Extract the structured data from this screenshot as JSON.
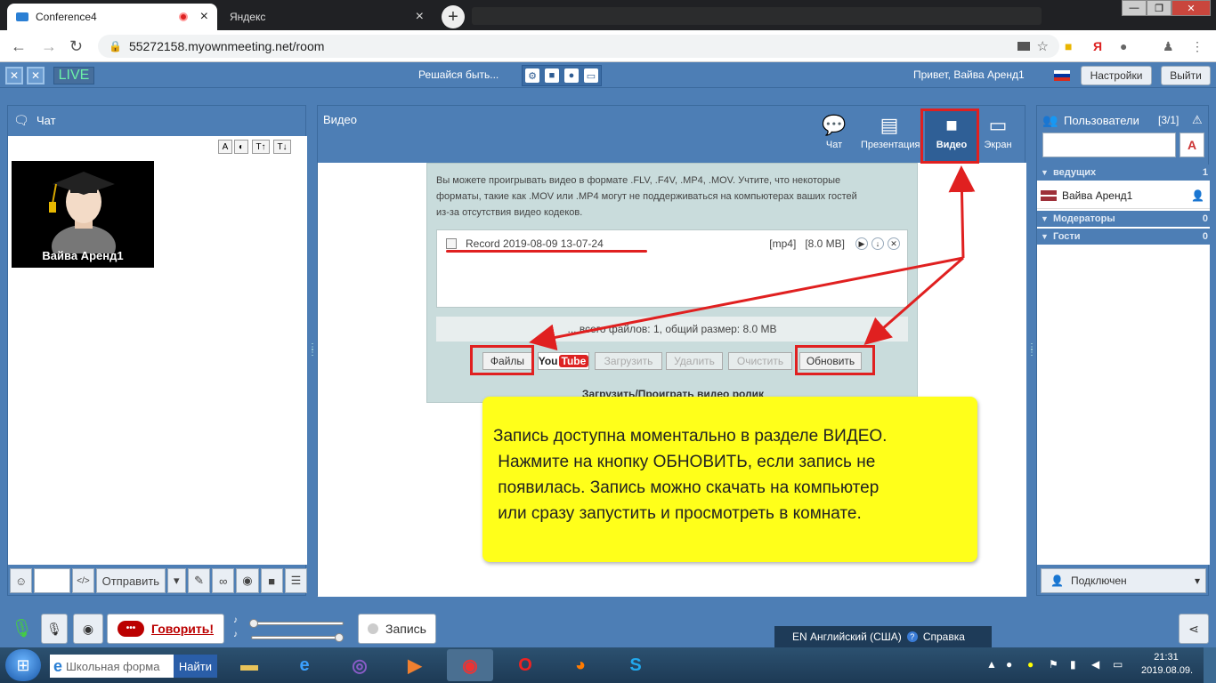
{
  "browser": {
    "tabs": [
      {
        "title": "Conference4",
        "active": true
      },
      {
        "title": "Яндекс",
        "active": false
      }
    ],
    "url": "55272158.myownmeeting.net/room",
    "new_tab": "+",
    "window_controls": [
      "—",
      "❐",
      "✕"
    ],
    "nav_icons": [
      "←",
      "→",
      "↻"
    ]
  },
  "app": {
    "logo_text": "LIVE",
    "motto": "Решайся быть...",
    "greeting": "Привет, Вайва Аренд1",
    "settings_label": "Настройки",
    "logout_label": "Выйти"
  },
  "chat": {
    "title": "Чат",
    "format_buttons": [
      "A",
      "◐",
      "T↑",
      "T↓"
    ],
    "avatar_name": "Вайва Аренд1",
    "emoji": "☺",
    "code": "</>",
    "send_label": "Отправить",
    "dropdown": "▾"
  },
  "video": {
    "title": "Видео",
    "tabs": [
      {
        "label": "Чат",
        "icon": "chat-bubble-icon"
      },
      {
        "label": "Презентация",
        "icon": "presentation-board-icon"
      },
      {
        "label": "Видео",
        "icon": "video-camera-icon"
      },
      {
        "label": "Экран",
        "icon": "monitor-screen-icon"
      }
    ],
    "info_text_1": "Вы можете проигрывать видео в формате .FLV, .F4V, .MP4, .MOV. Учтите, что некоторые",
    "info_text_2": "форматы, такие как .MOV или .MP4 могут не поддерживаться на компьютерах ваших гостей",
    "info_text_3": "из-за отсутствия видео кодеков.",
    "file": {
      "name": "Record 2019-08-09 13-07-24",
      "format": "[mp4]",
      "size": "[8.0 MB]"
    },
    "status": "... всего файлов: 1, общий размер: 8.0 MB",
    "buttons": {
      "files": "Файлы",
      "youtube_you": "You",
      "youtube_tube": "Tube",
      "upload": "Загрузить",
      "delete": "Удалить",
      "clear": "Очистить",
      "refresh": "Обновить"
    },
    "footer": "Загрузить/Проиграть видео ролик"
  },
  "callout": {
    "lines": [
      "Запись доступна моментально в разделе ВИДЕО.",
      " Нажмите на кнопку ОБНОВИТЬ, если запись не",
      " появилась. Запись можно скачать на компьютер",
      " или сразу запустить и просмотреть в комнате."
    ],
    "annotation_color": "#e02020",
    "background_color": "#ffff1a"
  },
  "users": {
    "title": "Пользователи",
    "count": "[3/1]",
    "groups": [
      {
        "name": "ведущих",
        "count": "1"
      },
      {
        "name": "Модераторы",
        "count": "0"
      },
      {
        "name": "Гости",
        "count": "0"
      }
    ],
    "host_user": "Вайва Аренд1",
    "status": "Подключен"
  },
  "bottom": {
    "speak_label": "Говорить!",
    "record_label": "Запись",
    "language": "EN Английский (США)",
    "help": "Справка"
  },
  "taskbar": {
    "search_placeholder": "Школьная форма",
    "search_button": "Найти",
    "time": "21:31",
    "date": "2019.08.09."
  }
}
